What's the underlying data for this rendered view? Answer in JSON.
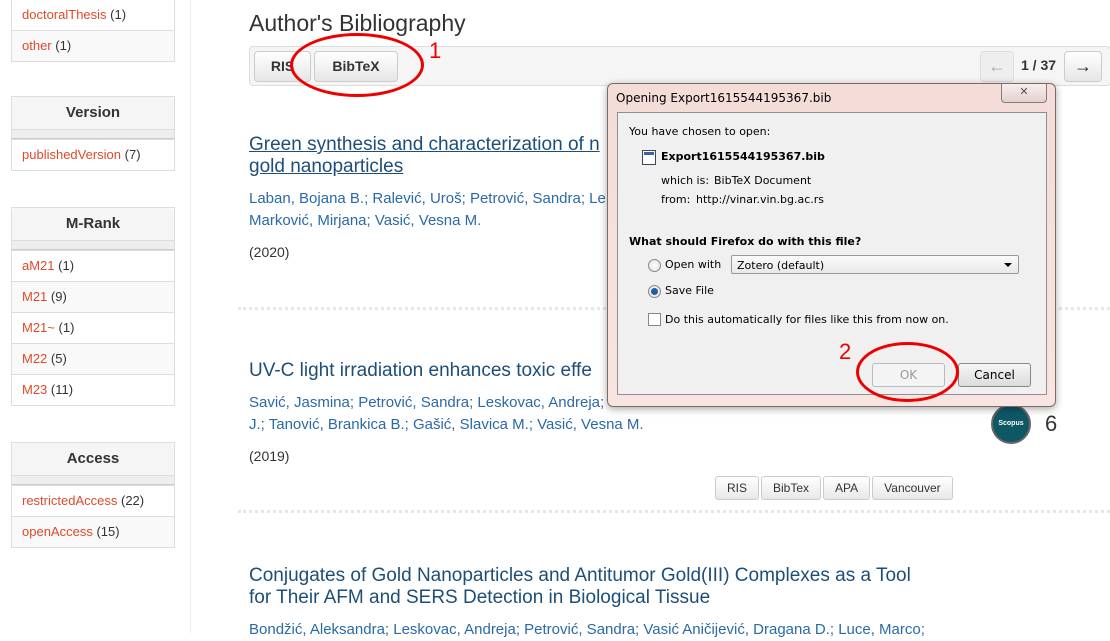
{
  "sidebar": {
    "facets": [
      {
        "title": null,
        "items": [
          {
            "label": "doctoralThesis",
            "count": "(1)"
          },
          {
            "label": "other",
            "count": "(1)"
          }
        ]
      },
      {
        "title": "Version",
        "items": [
          {
            "label": "publishedVersion",
            "count": "(7)"
          }
        ]
      },
      {
        "title": "M-Rank",
        "items": [
          {
            "label": "aM21",
            "count": "(1)"
          },
          {
            "label": "M21",
            "count": "(9)"
          },
          {
            "label": "M21~",
            "count": "(1)"
          },
          {
            "label": "M22",
            "count": "(5)"
          },
          {
            "label": "M23",
            "count": "(11)"
          }
        ]
      },
      {
        "title": "Access",
        "items": [
          {
            "label": "restrictedAccess",
            "count": "(22)"
          },
          {
            "label": "openAccess",
            "count": "(15)"
          }
        ]
      }
    ]
  },
  "main": {
    "title": "Author's Bibliography",
    "export_buttons": {
      "ris": "RIS",
      "bibtex": "BibTeX"
    },
    "pager": {
      "prev_icon": "arrow-left-icon",
      "text": "1 / 37",
      "next_icon": "arrow-right-icon",
      "prev": "←",
      "next": "→"
    },
    "publications": [
      {
        "title_line1": "Green synthesis and characterization of n",
        "title_line2": "gold nanoparticles",
        "authors_line1": "Laban, Bojana B.; Ralević, Uroš; Petrović, Sandra; Le",
        "authors_line2": "Marković, Mirjana; Vasić, Vesna M.",
        "year": "(2020)"
      },
      {
        "title_line1": "UV-C light irradiation enhances toxic effe",
        "authors_line1": "Savić, Jasmina; Petrović, Sandra; Leskovac, Andreja;",
        "authors_line2": "J.; Tanović, Brankica B.; Gašić, Slavica M.; Vasić, Vesna M.",
        "year": "(2019)",
        "scopus_label": "Scopus",
        "scopus_count": "6",
        "cite_buttons": [
          "RIS",
          "BibTex",
          "APA",
          "Vancouver"
        ]
      },
      {
        "title_line1": "Conjugates of Gold Nanoparticles and Antitumor Gold(III) Complexes as a Tool",
        "title_line2": "for Their AFM and SERS Detection in Biological Tissue",
        "authors_line1": "Bondžić, Aleksandra; Leskovac, Andreja; Petrović, Sandra; Vasić Aničijević, Dragana D.; Luce, Marco;"
      }
    ]
  },
  "dialog": {
    "title": "Opening Export1615544195367.bib",
    "close_glyph": "✕",
    "chosen_label": "You have chosen to open:",
    "filename": "Export1615544195367.bib",
    "which_is_label": "which is:",
    "which_is_value": "BibTeX Document",
    "from_label": "from:",
    "from_value": "http://vinar.vin.bg.ac.rs",
    "question": "What should Firefox do with this file?",
    "open_with_label": "Open with",
    "open_with_app": "Zotero (default)",
    "save_file_label": "Save File",
    "selected_option": "save_file",
    "auto_checkbox_label": "Do this automatically for files like this from now on.",
    "auto_checked": false,
    "ok_label": "OK",
    "cancel_label": "Cancel"
  },
  "annotations": {
    "step1": "1",
    "step2": "2",
    "color": "#e00000"
  }
}
